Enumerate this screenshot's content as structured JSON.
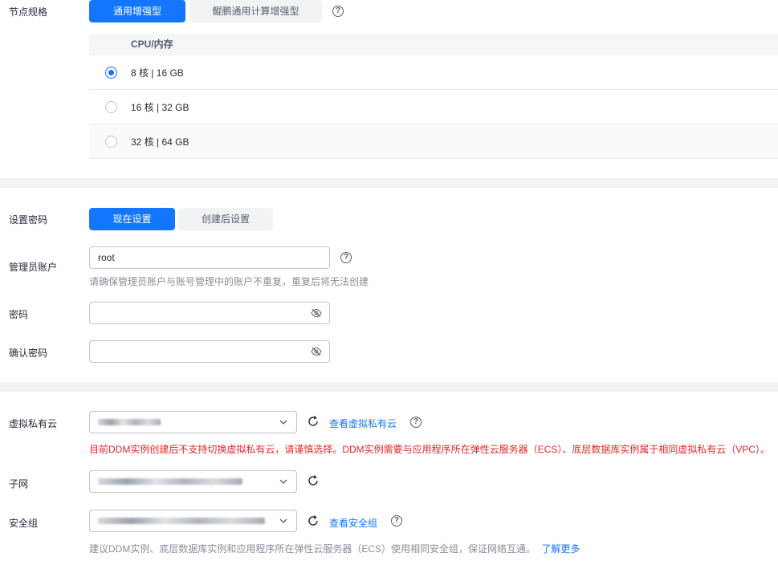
{
  "node_spec": {
    "label": "节点规格",
    "tabs": [
      "通用增强型",
      "鲲鹏通用计算增强型"
    ],
    "table_header": "CPU/内存",
    "options": [
      "8 核 | 16 GB",
      "16 核 | 32 GB",
      "32 核 | 64 GB"
    ],
    "selected_index": 0
  },
  "password_setting": {
    "label": "设置密码",
    "tabs": [
      "现在设置",
      "创建后设置"
    ]
  },
  "admin_account": {
    "label": "管理员账户",
    "value": "root",
    "hint": "请确保管理员账户与账号管理中的账户不重复，重复后将无法创建"
  },
  "password": {
    "label": "密码",
    "value": ""
  },
  "confirm_password": {
    "label": "确认密码",
    "value": ""
  },
  "vpc": {
    "label": "虚拟私有云",
    "link": "查看虚拟私有云",
    "warning": "目前DDM实例创建后不支持切换虚拟私有云，请谨慎选择。DDM实例需要与应用程序所在弹性云服务器（ECS）、底层数据库实例属于相同虚拟私有云（VPC）。"
  },
  "subnet": {
    "label": "子网"
  },
  "security_group": {
    "label": "安全组",
    "link": "查看安全组",
    "hint": "建议DDM实例、底层数据库实例和应用程序所在弹性云服务器（ECS）使用相同安全组，保证网络互通。",
    "more_link": "了解更多"
  },
  "help_symbol": "?",
  "colors": {
    "primary": "#1476ff",
    "warning": "#e5262b",
    "muted": "#8a8e99"
  }
}
